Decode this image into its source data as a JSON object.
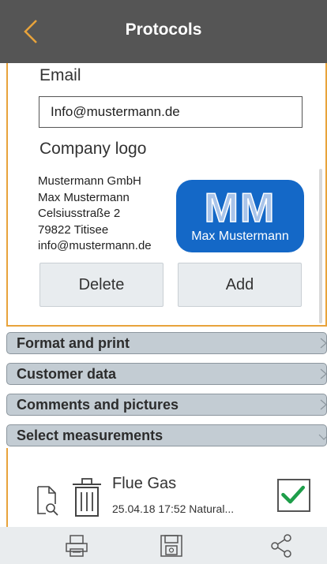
{
  "header": {
    "title": "Protocols",
    "back_icon": "chevron-left-icon"
  },
  "form": {
    "email_label": "Email",
    "email_value": "Info@mustermann.de",
    "logo_label": "Company logo",
    "address_lines": [
      "Mustermann GmbH",
      "Max Mustermann",
      "Celsiusstraße 2",
      "79822 Titisee",
      "info@mustermann.de"
    ],
    "logo_initials": "MM",
    "logo_name": "Max Mustermann",
    "delete_label": "Delete",
    "add_label": "Add"
  },
  "sections": [
    {
      "label": "Format and print",
      "state": "collapsed"
    },
    {
      "label": "Customer data",
      "state": "collapsed"
    },
    {
      "label": "Comments and pictures",
      "state": "collapsed"
    },
    {
      "label": "Select measurements",
      "state": "expanded"
    }
  ],
  "measurement": {
    "title": "Flue Gas",
    "subtitle": "25.04.18  17:52  Natural...",
    "checked": true
  },
  "bottom_bar": {
    "icons": [
      "printer-icon",
      "save-icon",
      "share-icon"
    ]
  },
  "colors": {
    "header_bg": "#555555",
    "accent": "#e8a33b",
    "section_bg": "#c3ccd3",
    "check": "#1e9e4a",
    "logo_bg": "#1468c7"
  }
}
